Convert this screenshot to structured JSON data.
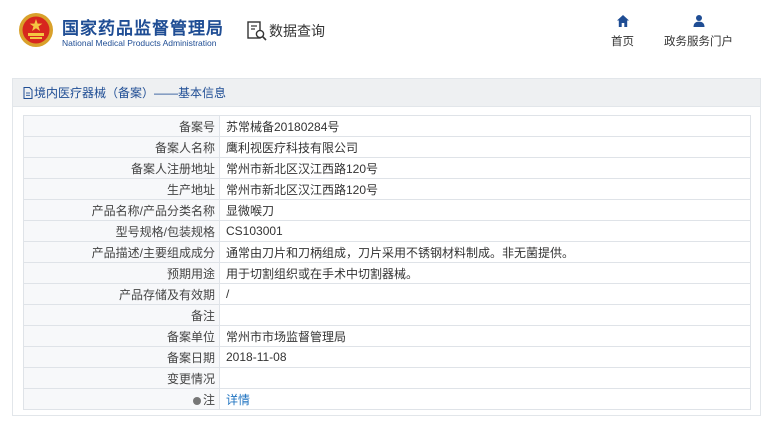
{
  "header": {
    "org_cn": "国家药品监督管理局",
    "org_en": "National Medical Products Administration",
    "query_label": "数据查询",
    "nav": [
      {
        "label": "首页",
        "icon": "home-icon"
      },
      {
        "label": "政务服务门户",
        "icon": "user-icon"
      }
    ]
  },
  "panel": {
    "title": "境内医疗器械（备案）——基本信息"
  },
  "record": [
    {
      "label": "备案号",
      "value": "苏常械备20180284号"
    },
    {
      "label": "备案人名称",
      "value": "鹰利视医疗科技有限公司"
    },
    {
      "label": "备案人注册地址",
      "value": "常州市新北区汉江西路120号"
    },
    {
      "label": "生产地址",
      "value": "常州市新北区汉江西路120号"
    },
    {
      "label": "产品名称/产品分类名称",
      "value": "显微喉刀"
    },
    {
      "label": "型号规格/包装规格",
      "value": "CS103001"
    },
    {
      "label": "产品描述/主要组成成分",
      "value": "通常由刀片和刀柄组成，刀片采用不锈钢材料制成。非无菌提供。"
    },
    {
      "label": "预期用途",
      "value": "用于切割组织或在手术中切割器械。"
    },
    {
      "label": "产品存储及有效期",
      "value": "/"
    },
    {
      "label": "备注",
      "value": ""
    },
    {
      "label": "备案单位",
      "value": "常州市市场监督管理局"
    },
    {
      "label": "备案日期",
      "value": "2018-11-08"
    },
    {
      "label": "变更情况",
      "value": ""
    }
  ],
  "note_row": {
    "label": "注",
    "link": "详情"
  },
  "colors": {
    "brand": "#1f4d94",
    "link": "#1f73c0",
    "header_bg": "#eef0f2"
  }
}
